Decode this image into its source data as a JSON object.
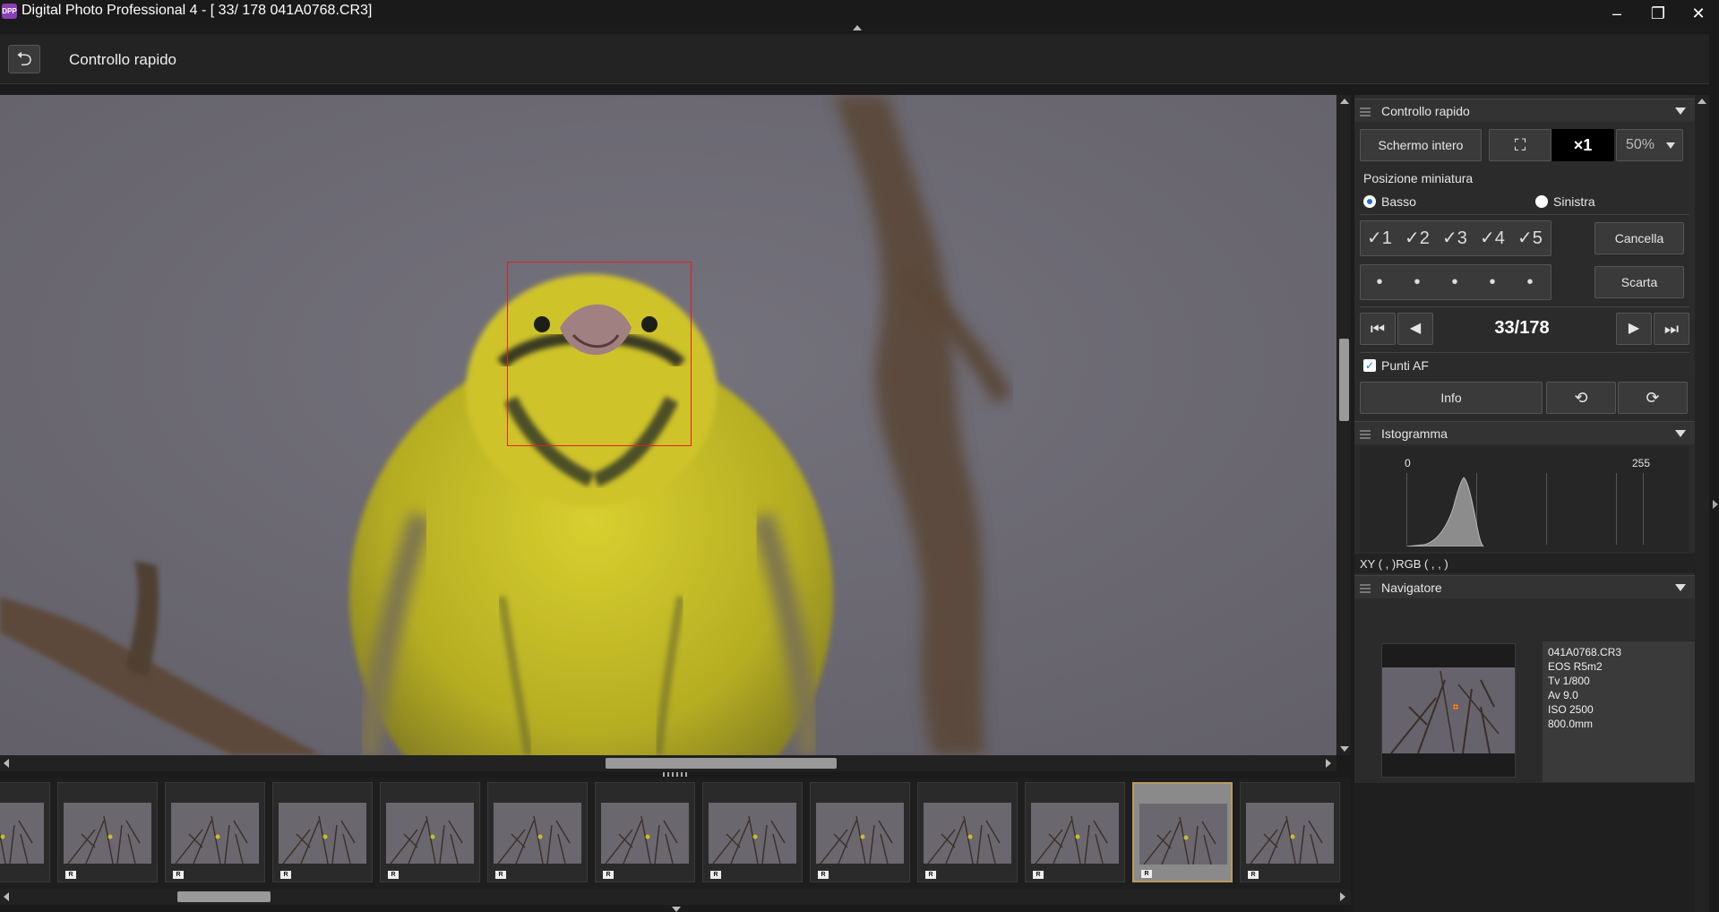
{
  "window": {
    "logo_text": "DPP",
    "title": "Digital Photo Professional 4 - [  33/ 178 041A0768.CR3]",
    "minimize": "–",
    "restore": "❐",
    "close": "✕"
  },
  "toolbar": {
    "back_glyph": "⮌",
    "title": "Controllo rapido"
  },
  "filmstrip": {
    "count": 13,
    "selected_index": 11,
    "raw_badge": "R"
  },
  "panel": {
    "quick_check": {
      "title": "Controllo rapido",
      "full_screen": "Schermo intero",
      "fit_glyph": "⛶",
      "zoom_x1": "×1",
      "zoom_value": "50%",
      "thumb_position_label": "Posizione miniatura",
      "radio_bottom": "Basso",
      "radio_left": "Sinistra",
      "ratings": [
        "✓1",
        "✓2",
        "✓3",
        "✓4",
        "✓5"
      ],
      "cancel": "Cancella",
      "labels_dots": [
        "•",
        "•",
        "•",
        "•",
        "•"
      ],
      "discard": "Scarta",
      "first_glyph": "⏮",
      "prev_glyph": "◀",
      "counter": "33/178",
      "next_glyph": "▶",
      "last_glyph": "⏭",
      "af_points": "Punti AF",
      "af_check_glyph": "✓",
      "info": "Info",
      "rotate_left_glyph": "⟲",
      "rotate_right_glyph": "⟳"
    },
    "histogram": {
      "title": "Istogramma",
      "min": "0",
      "max": "255",
      "readout": "XY (    ,     )RGB (    ,    ,    )"
    },
    "navigator": {
      "title": "Navigatore",
      "info": [
        "041A0768.CR3",
        "EOS R5m2",
        "Tv 1/800",
        "Av 9.0",
        "ISO 2500",
        "800.0mm"
      ]
    }
  },
  "colors": {
    "af_box": "#e02020",
    "selection_border": "#b79a63",
    "radio_accent": "#1e6fd9"
  }
}
